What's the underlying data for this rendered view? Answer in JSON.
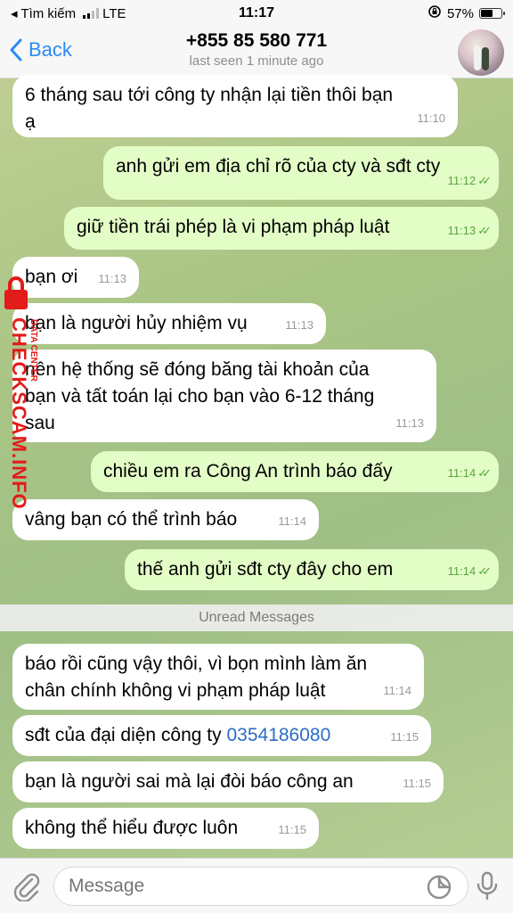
{
  "status": {
    "carrier_back": "◂ Tìm kiếm",
    "network": "LTE",
    "time": "11:17",
    "battery": "57%",
    "battery_level": 0.57
  },
  "header": {
    "back_label": "Back",
    "title": "+855 85 580 771",
    "subtitle": "last seen 1 minute ago"
  },
  "messages": [
    {
      "dir": "in",
      "lines": [
        "6 tháng sau tới công ty nhận lại tiền thôi bạn",
        "ạ"
      ],
      "time": "11:10"
    },
    {
      "dir": "out",
      "lines": [
        "anh gửi em địa chỉ rõ của cty và sđt cty"
      ],
      "time": "11:12"
    },
    {
      "dir": "out",
      "lines": [
        "giữ tiền trái phép là vi phạm pháp luật"
      ],
      "time": "11:13"
    },
    {
      "dir": "in",
      "lines": [
        "bạn ơi"
      ],
      "time": "11:13"
    },
    {
      "dir": "in",
      "lines": [
        "bạn là người hủy nhiệm vụ"
      ],
      "time": "11:13"
    },
    {
      "dir": "in",
      "lines": [
        "nên hệ thống sẽ đóng băng tài khoản của",
        "bạn và tất toán lại cho bạn vào 6-12 tháng",
        "sau"
      ],
      "time": "11:13"
    },
    {
      "dir": "out",
      "lines": [
        "chiều em ra Công An trình báo đấy"
      ],
      "time": "11:14"
    },
    {
      "dir": "in",
      "lines": [
        "vâng bạn có thể trình báo"
      ],
      "time": "11:14"
    },
    {
      "dir": "out",
      "lines": [
        "thế anh gửi sđt cty đây cho em"
      ],
      "time": "11:14"
    },
    {
      "dir": "in",
      "lines": [
        "báo rồi cũng vậy thôi, vì bọn mình làm ăn",
        "chân chính không vi phạm pháp luật"
      ],
      "time": "11:14"
    },
    {
      "dir": "in",
      "prefix": "sđt của đại diện công ty ",
      "link": "0354186080",
      "time": "11:15"
    },
    {
      "dir": "in",
      "lines": [
        "bạn là người sai mà lại đòi báo công an"
      ],
      "time": "11:15"
    },
    {
      "dir": "in",
      "lines": [
        "không thể hiểu được luôn"
      ],
      "time": "11:15"
    }
  ],
  "unread_label": "Unread Messages",
  "watermark": {
    "main": "CHECKSCAM.INFO",
    "small": "DATA CENTER"
  },
  "input": {
    "placeholder": "Message"
  },
  "colors": {
    "accent": "#2a8bf2",
    "outgoing_bubble": "#e3fdc7",
    "incoming_bubble": "#ffffff",
    "watermark": "#e21b1b"
  }
}
